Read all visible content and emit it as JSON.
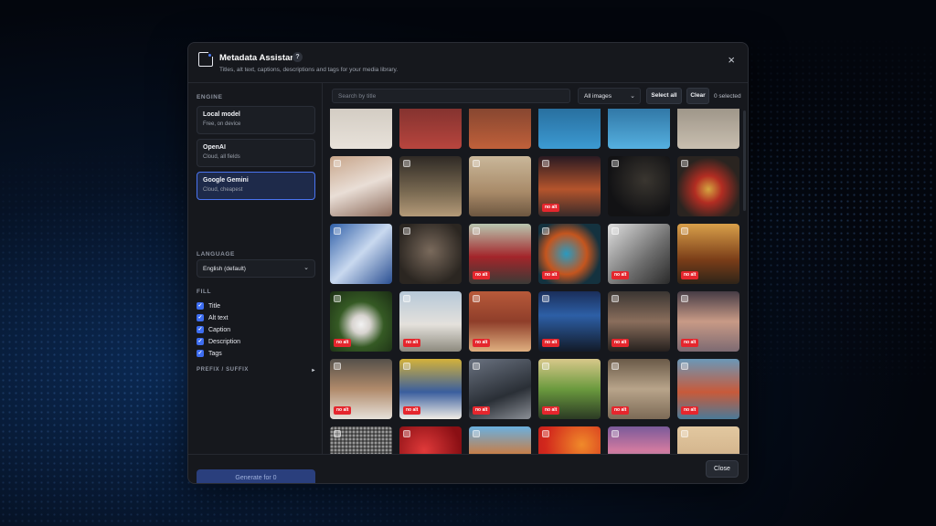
{
  "dialog": {
    "title": "Metadata Assistant",
    "help": "?",
    "subtitle": "Titles, alt text, captions, descriptions and tags for your media library.",
    "close_icon": "×"
  },
  "sidebar": {
    "engine_label": "ENGINE",
    "engines": [
      {
        "name": "Local model",
        "desc": "Free, on device",
        "active": false
      },
      {
        "name": "OpenAI",
        "desc": "Cloud, all fields",
        "active": false
      },
      {
        "name": "Google Gemini",
        "desc": "Cloud, cheapest",
        "active": true
      }
    ],
    "language_label": "LANGUAGE",
    "language_value": "English (default)",
    "fill_label": "FILL",
    "fill_items": [
      "Title",
      "Alt text",
      "Caption",
      "Description",
      "Tags"
    ],
    "prefix_label": "PREFIX / SUFFIX",
    "prefix_arrow": "▸",
    "generate_label": "Generate for 0"
  },
  "toolbar": {
    "search_placeholder": "Search by title",
    "filter_value": "All images",
    "select_all": "Select all",
    "clear": "Clear",
    "selected_count": "0 selected"
  },
  "grid": {
    "badge_text": "no alt",
    "tiles": [
      {
        "bg": "linear-gradient(180deg,#c9c2b8,#e8e2da)",
        "badge": false
      },
      {
        "bg": "linear-gradient(180deg,#6b2a28,#b8453e)",
        "badge": false
      },
      {
        "bg": "linear-gradient(180deg,#6b3a2c,#c0603a)",
        "badge": false
      },
      {
        "bg": "linear-gradient(180deg,#1e5a86,#3c9ad2)",
        "badge": false
      },
      {
        "bg": "linear-gradient(180deg,#1f5c8a,#55b0e0)",
        "badge": false
      },
      {
        "bg": "linear-gradient(180deg,#8a8276,#c9bfb0)",
        "badge": false
      },
      {
        "bg": "linear-gradient(160deg,#c7a58a,#e9ded6 50%,#8b6a5a)",
        "badge": false
      },
      {
        "bg": "linear-gradient(180deg,#2f2a25,#7a6a52 60%,#b49a78)",
        "badge": false
      },
      {
        "bg": "linear-gradient(180deg,#c9b79a,#a88a68 60%,#6c5640)",
        "badge": false
      },
      {
        "bg": "linear-gradient(180deg,#2a1a22,#b4542c 55%,#3a2b2a)",
        "badge": true
      },
      {
        "bg": "radial-gradient(ellipse at 60% 40%,#3a3630,#121214 70%)",
        "badge": false
      },
      {
        "bg": "radial-gradient(circle at 50% 55%,#d5a640 0%,#b22d22 30%,#2a2420 70%)",
        "badge": false
      },
      {
        "bg": "linear-gradient(135deg,#2f5fa8,#c9d9ef 50%,#2a4f92)",
        "badge": false
      },
      {
        "bg": "radial-gradient(circle at 50% 45%,#7a6a5c,#2b2621 75%)",
        "badge": false
      },
      {
        "bg": "linear-gradient(180deg,#b9c7b0,#a3252a 55%,#3a3a36)",
        "badge": true
      },
      {
        "bg": "radial-gradient(circle at 45% 50%,#2a9ac0,#c4551e 45%,#14323f 75%)",
        "badge": true
      },
      {
        "bg": "linear-gradient(135deg,#e0e0e0,#6c6c6c 60%,#2a2a2a)",
        "badge": true
      },
      {
        "bg": "linear-gradient(180deg,#d9a04a,#7a3d18 60%,#2e2418)",
        "badge": true
      },
      {
        "bg": "radial-gradient(circle at 50% 55%,#f2f2f2 0%,#d8d4d0 20%,#355a24 50%,#1b2d14)",
        "badge": true
      },
      {
        "bg": "linear-gradient(180deg,#b6c8d8,#e4e1dc 55%,#8d8a7e)",
        "badge": true
      },
      {
        "bg": "linear-gradient(180deg,#b85a3a,#8f3e2a 50%,#e0b080)",
        "badge": true
      },
      {
        "bg": "linear-gradient(180deg,#1a2e5a,#2d5fa6 40%,#121a28)",
        "badge": true
      },
      {
        "bg": "linear-gradient(180deg,#3a3532,#8a6e5c 50%,#25201e)",
        "badge": true
      },
      {
        "bg": "linear-gradient(180deg,#463c45,#c89a86 50%,#7d6a72)",
        "badge": true
      },
      {
        "bg": "linear-gradient(180deg,#55504a,#b08a6a 50%,#e6e1da)",
        "badge": true
      },
      {
        "bg": "linear-gradient(180deg,#d4b23a,#3a5e9e 55%,#f1ede6)",
        "badge": true
      },
      {
        "bg": "linear-gradient(160deg,#6a7280,#2a2f36 60%,#8b8f96)",
        "badge": true
      },
      {
        "bg": "linear-gradient(180deg,#d8c88a,#6b9a3e 50%,#2b3a24)",
        "badge": true
      },
      {
        "bg": "linear-gradient(180deg,#6a5a48,#b8a48a 50%,#7c6a56)",
        "badge": true
      },
      {
        "bg": "linear-gradient(180deg,#6a98b8,#c85a3a 55%,#4a7a98)",
        "badge": true
      },
      {
        "bg": "radial-gradient(circle,#9a9a9a 1px,#3a3a3a 2px)",
        "badge": true
      },
      {
        "bg": "radial-gradient(circle at 40% 40%,#e03a3a,#8a0f14 70%)",
        "badge": true
      },
      {
        "bg": "linear-gradient(180deg,#6ab0e0,#d9742a 55%,#2a4a6a)",
        "badge": true
      },
      {
        "bg": "radial-gradient(circle at 70% 30%,#f08a2a,#d2281c 60%,#b8181a)",
        "badge": false
      },
      {
        "bg": "linear-gradient(180deg,#7a5a9a,#d27aa0 40%,#2a8aa0)",
        "badge": false
      },
      {
        "bg": "linear-gradient(180deg,#e2c8a0,#d0b088 60%,#c8a070)",
        "badge": true
      }
    ]
  },
  "footer": {
    "close_label": "Close"
  },
  "colors": {
    "accent": "#3d6df0",
    "badge": "#e5262d",
    "panel": "#16181d"
  }
}
